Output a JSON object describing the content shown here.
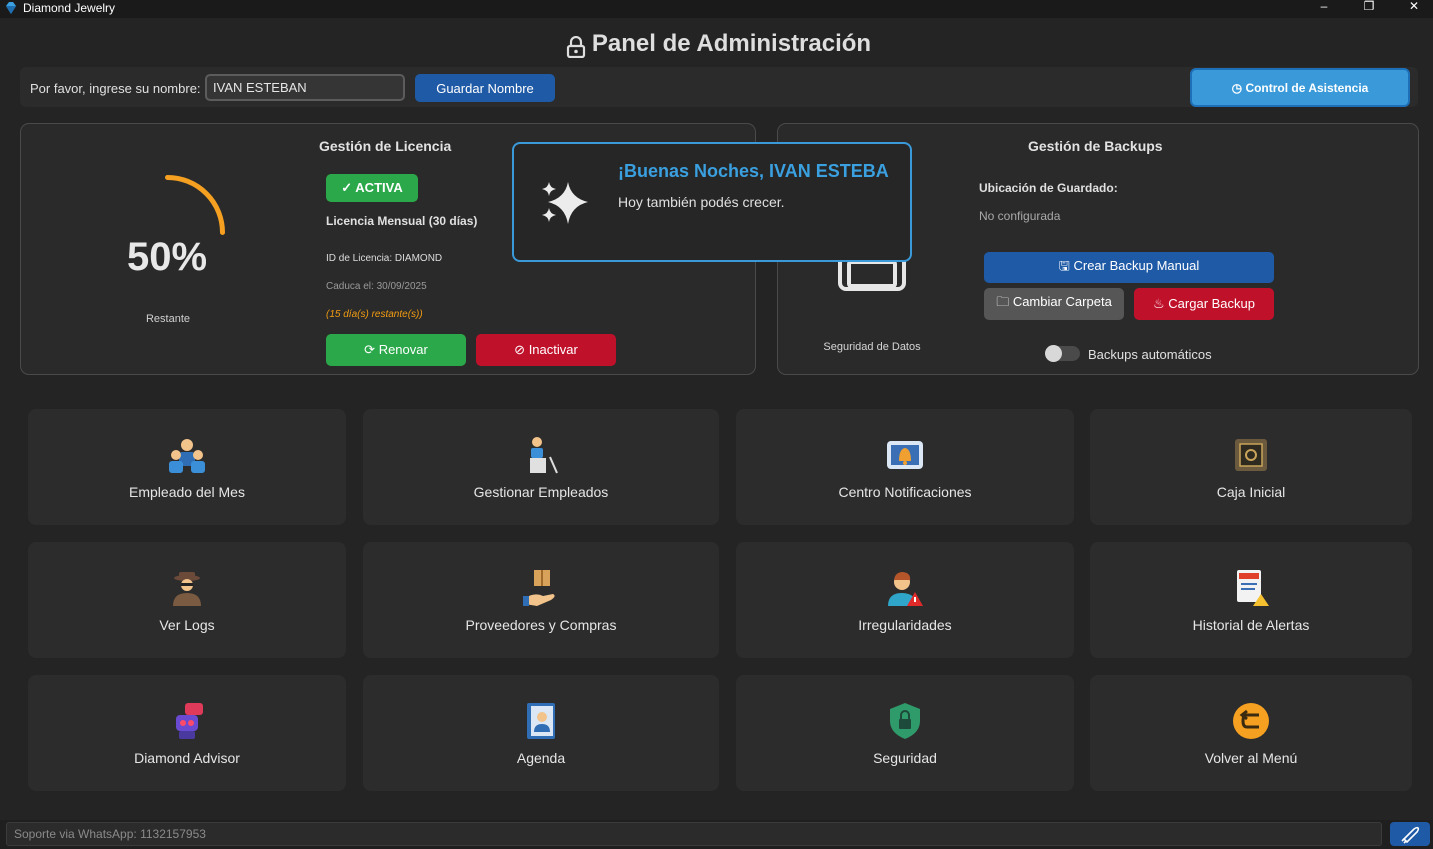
{
  "window": {
    "title": "Diamond Jewelry",
    "minimize": "–",
    "maximize": "❐",
    "close": "✕"
  },
  "header": {
    "title": "Panel de Administración"
  },
  "name_row": {
    "label": "Por favor, ingrese su nombre:",
    "input_value": "IVAN ESTEBAN",
    "save_label": "Guardar Nombre",
    "attendance_label": "Control de Asistencia"
  },
  "license": {
    "title": "Gestión de Licencia",
    "percent_text": "50%",
    "percent_value": 50,
    "remaining_label": "Restante",
    "status": "✓ ACTIVA",
    "type": "Licencia Mensual (30 días)",
    "id": "ID de Licencia: DIAMOND",
    "expires": "Caduca el: 30/09/2025",
    "days_left": "(15 día(s) restante(s))",
    "renew_label": "Renovar",
    "deactivate_label": "Inactivar"
  },
  "backups": {
    "title": "Gestión de Backups",
    "location_label": "Ubicación de Guardado:",
    "location_value": "No configurada",
    "security_caption": "Seguridad de Datos",
    "create_label": "Crear Backup Manual",
    "change_folder_label": "Cambiar Carpeta",
    "load_label": "Cargar Backup",
    "auto_label": "Backups automáticos",
    "auto_enabled": false
  },
  "toast": {
    "title": "¡Buenas Noches, IVAN ESTEBA",
    "message": "Hoy también podés crecer."
  },
  "tiles": [
    {
      "label": "Empleado del Mes",
      "icon": "employees-group-icon"
    },
    {
      "label": "Gestionar Empleados",
      "icon": "manage-employee-icon"
    },
    {
      "label": "Centro Notificaciones",
      "icon": "notification-bell-icon"
    },
    {
      "label": "Caja Inicial",
      "icon": "safe-box-icon"
    },
    {
      "label": "Ver Logs",
      "icon": "detective-icon"
    },
    {
      "label": "Proveedores y Compras",
      "icon": "package-hand-icon"
    },
    {
      "label": "Irregularidades",
      "icon": "person-warning-icon"
    },
    {
      "label": "Historial de Alertas",
      "icon": "audit-document-icon"
    },
    {
      "label": "Diamond Advisor",
      "icon": "robot-chat-icon"
    },
    {
      "label": "Agenda",
      "icon": "contact-book-icon"
    },
    {
      "label": "Seguridad",
      "icon": "shield-lock-icon"
    },
    {
      "label": "Volver al Menú",
      "icon": "return-arrow-icon"
    }
  ],
  "footer": {
    "support_text": "Soporte via WhatsApp: 1132157953"
  },
  "colors": {
    "accent_blue": "#1f5aa6",
    "green": "#2aa84a",
    "red": "#c0112b",
    "orange": "#f39c12",
    "toast_border": "#3a9ad9"
  }
}
